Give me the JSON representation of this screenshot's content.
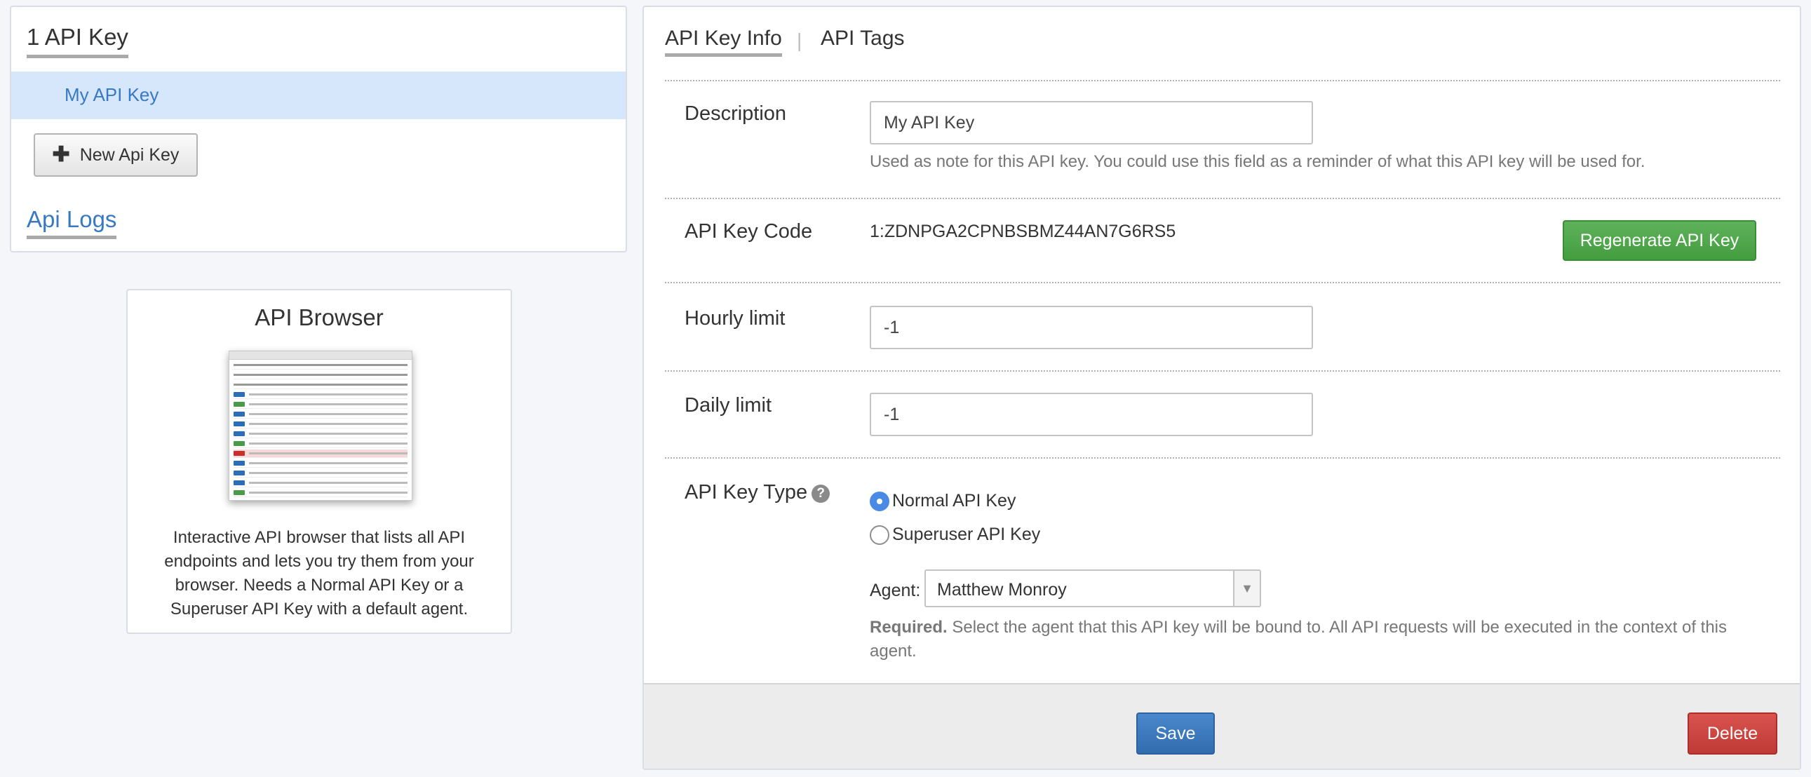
{
  "sidebar": {
    "title": "1 API Key",
    "keys": [
      {
        "label": "My API Key"
      }
    ],
    "new_key_label": "New Api Key",
    "logs_label": "Api Logs"
  },
  "browser": {
    "title": "API Browser",
    "description": "Interactive API browser that lists all API endpoints and lets you try them from your browser. Needs a Normal API Key or a Superuser API Key with a default agent."
  },
  "tabs": [
    {
      "label": "API Key Info",
      "active": true
    },
    {
      "label": "API Tags",
      "active": false
    }
  ],
  "form": {
    "description_label": "Description",
    "description_value": "My API Key",
    "description_help": "Used as note for this API key. You could use this field as a reminder of what this API key will be used for.",
    "code_label": "API Key Code",
    "code_value": "1:ZDNPGA2CPNBSBMZ44AN7G6RS5",
    "regenerate_label": "Regenerate API Key",
    "hourly_label": "Hourly limit",
    "hourly_value": "-1",
    "daily_label": "Daily limit",
    "daily_value": "-1",
    "type_label": "API Key Type",
    "type_help_icon": "?",
    "type_options": [
      {
        "label": "Normal API Key",
        "checked": true
      },
      {
        "label": "Superuser API Key",
        "checked": false
      }
    ],
    "agent_label": "Agent:",
    "agent_value": "Matthew Monroy",
    "required_strong": "Required.",
    "required_text": " Select the agent that this API key will be bound to. All API requests will be executed in the context of this agent."
  },
  "footer": {
    "save_label": "Save",
    "delete_label": "Delete"
  },
  "colors": {
    "link": "#3879c4",
    "selected_row": "#d6e6fb",
    "regenerate": "#4ca448",
    "save": "#3b7bc0",
    "delete": "#cc4541",
    "radio_checked": "#4a8ae6"
  },
  "icons": {
    "plus": "plus-icon",
    "help": "question-circle-icon",
    "dropdown": "chevron-down-icon"
  }
}
